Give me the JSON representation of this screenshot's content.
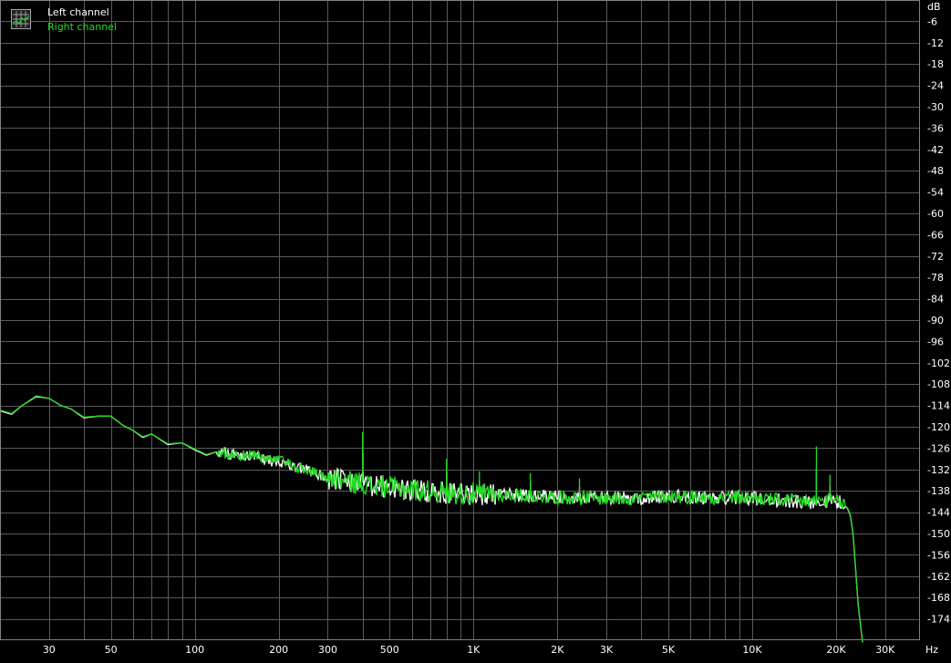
{
  "chart_data": {
    "type": "line",
    "title": "",
    "xlabel": "Hz",
    "ylabel": "dB",
    "x_scale": "log",
    "xlim": [
      20,
      40000
    ],
    "ylim": [
      -180,
      0
    ],
    "grid": true,
    "legend_position": "top-left",
    "x_tick_labels": [
      {
        "value": 30,
        "label": "30"
      },
      {
        "value": 50,
        "label": "50"
      },
      {
        "value": 100,
        "label": "100"
      },
      {
        "value": 200,
        "label": "200"
      },
      {
        "value": 300,
        "label": "300"
      },
      {
        "value": 500,
        "label": "500"
      },
      {
        "value": 1000,
        "label": "1K"
      },
      {
        "value": 2000,
        "label": "2K"
      },
      {
        "value": 3000,
        "label": "3K"
      },
      {
        "value": 5000,
        "label": "5K"
      },
      {
        "value": 10000,
        "label": "10K"
      },
      {
        "value": 20000,
        "label": "20K"
      },
      {
        "value": 30000,
        "label": "30K"
      }
    ],
    "y_tick_labels": [
      "-6",
      "-12",
      "-18",
      "-24",
      "-30",
      "-36",
      "-42",
      "-48",
      "-54",
      "-60",
      "-66",
      "-72",
      "-78",
      "-84",
      "-90",
      "-96",
      "-102",
      "-108",
      "-114",
      "-120",
      "-126",
      "-132",
      "-138",
      "-144",
      "-150",
      "-156",
      "-162",
      "-168",
      "-174"
    ],
    "colors": {
      "background": "#000000",
      "grid": "#5a5a5a",
      "axis_text": "#ffffff",
      "left_channel": "#ffffff",
      "right_channel": "#22dd22"
    },
    "series": [
      {
        "name": "Left channel",
        "color": "#ffffff",
        "x": [
          20,
          22,
          24,
          27,
          30,
          33,
          36,
          40,
          45,
          50,
          55,
          60,
          65,
          70,
          80,
          90,
          100,
          110,
          120,
          140,
          160,
          180,
          200,
          230,
          260,
          300,
          340,
          370,
          400,
          430,
          470,
          520,
          580,
          650,
          720,
          780,
          850,
          950,
          1000,
          1100,
          1300,
          1500,
          1700,
          2000,
          2300,
          2500,
          2800,
          3000,
          3500,
          4000,
          5000,
          6000,
          7000,
          8000,
          9000,
          10000,
          11000,
          12000,
          14000,
          16000,
          17000,
          18000,
          20000,
          21000,
          22000,
          22500,
          23000,
          23500,
          24000,
          25000
        ],
        "y": [
          -115.5,
          -116.5,
          -114,
          -111.5,
          -112,
          -114,
          -115,
          -117.5,
          -117,
          -117,
          -119.5,
          -121,
          -123,
          -122,
          -125,
          -124.5,
          -126.5,
          -128,
          -127,
          -128,
          -128,
          -129.5,
          -129.5,
          -131.5,
          -132.5,
          -134.5,
          -135.2,
          -136,
          -135.6,
          -137,
          -136.8,
          -137.3,
          -137.5,
          -138.1,
          -138.4,
          -138.6,
          -138.7,
          -139,
          -138.8,
          -139,
          -139.3,
          -139.4,
          -139.6,
          -139.8,
          -140,
          -140,
          -140.1,
          -140.1,
          -140.2,
          -140,
          -139.6,
          -139.8,
          -140,
          -139.8,
          -140,
          -140.1,
          -140.4,
          -140.6,
          -141,
          -141.2,
          -141,
          -140.8,
          -141,
          -141.5,
          -143,
          -145,
          -150,
          -160,
          -170,
          -182
        ]
      },
      {
        "name": "Right channel",
        "color": "#22dd22",
        "x": [
          20,
          22,
          24,
          27,
          30,
          33,
          36,
          40,
          45,
          50,
          55,
          60,
          65,
          70,
          80,
          90,
          100,
          110,
          120,
          140,
          160,
          180,
          200,
          230,
          260,
          300,
          340,
          370,
          400,
          430,
          470,
          520,
          580,
          650,
          720,
          780,
          850,
          950,
          1000,
          1100,
          1300,
          1500,
          1700,
          2000,
          2300,
          2500,
          2800,
          3000,
          3500,
          4000,
          5000,
          6000,
          7000,
          8000,
          9000,
          10000,
          11000,
          12000,
          14000,
          16000,
          17000,
          18000,
          20000,
          21000,
          22000,
          22500,
          23000,
          23500,
          24000,
          25000
        ],
        "y": [
          -115.3,
          -116.3,
          -114,
          -111.3,
          -112,
          -114,
          -115,
          -117.3,
          -117,
          -117,
          -119.5,
          -121,
          -122.8,
          -122,
          -124.8,
          -124.5,
          -126.3,
          -127.8,
          -127,
          -128,
          -128,
          -129.2,
          -129.5,
          -131.4,
          -132.4,
          -134.3,
          -135,
          -135.8,
          -135.5,
          -136.9,
          -136.7,
          -137.2,
          -137.3,
          -138,
          -138.2,
          -138.5,
          -138.6,
          -138.8,
          -138.8,
          -138.9,
          -139.2,
          -139.3,
          -139.5,
          -139.7,
          -139.9,
          -139.9,
          -140,
          -140.1,
          -140.1,
          -139.9,
          -139.5,
          -139.7,
          -139.9,
          -139.7,
          -139.9,
          -140,
          -140.3,
          -140.5,
          -140.9,
          -141.1,
          -140.9,
          -140.7,
          -140.9,
          -141.4,
          -142.8,
          -144.8,
          -150,
          -160,
          -170,
          -182
        ]
      }
    ],
    "spurs": [
      {
        "x": 400,
        "y": -121.5,
        "series": "Right channel"
      },
      {
        "x": 800,
        "y": -129,
        "series": "Right channel"
      },
      {
        "x": 1050,
        "y": -132.5,
        "series": "Right channel"
      },
      {
        "x": 1600,
        "y": -133,
        "series": "Right channel"
      },
      {
        "x": 2400,
        "y": -134.5,
        "series": "Right channel"
      },
      {
        "x": 17000,
        "y": -125.5,
        "series": "Right channel"
      },
      {
        "x": 19000,
        "y": -133.5,
        "series": "Right channel"
      },
      {
        "x": 15600,
        "y": -139,
        "series": "Right channel"
      }
    ]
  }
}
